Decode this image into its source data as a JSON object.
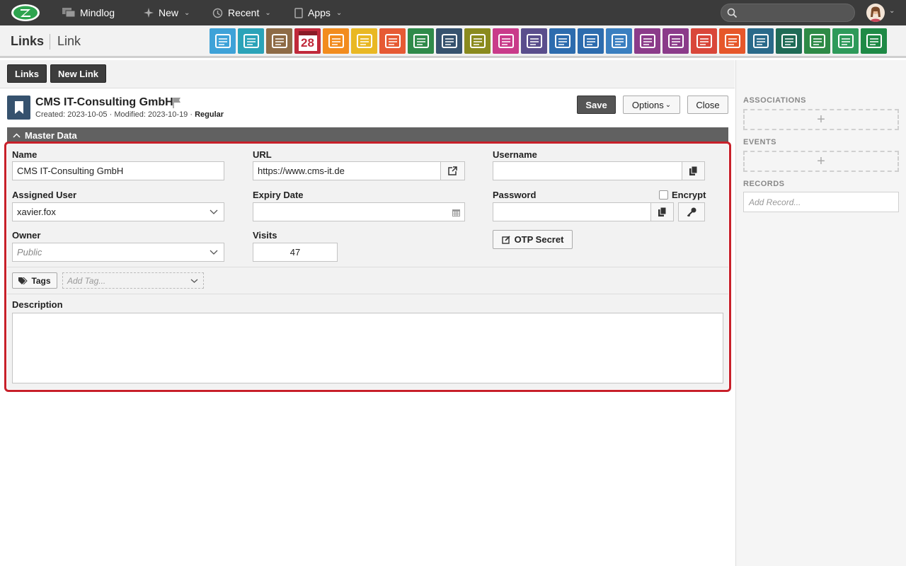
{
  "topnav": {
    "home": "Mindlog",
    "new": "New",
    "recent": "Recent",
    "apps": "Apps",
    "search_placeholder": ""
  },
  "breadcrumb": {
    "module": "Links",
    "page": "Link"
  },
  "app_icons": [
    {
      "name": "mail-icon",
      "color": "#3ea2d8"
    },
    {
      "name": "address-book-icon",
      "color": "#2ba3b8"
    },
    {
      "name": "contacts-icon",
      "color": "#8e6b46"
    },
    {
      "name": "calendar-icon",
      "color": "#c0293a",
      "text": "28"
    },
    {
      "name": "stopwatch-icon",
      "color": "#f28c1e"
    },
    {
      "name": "tasks-icon",
      "color": "#e9b824"
    },
    {
      "name": "projects-icon",
      "color": "#e65a34"
    },
    {
      "name": "notes-icon",
      "color": "#2f8a4a"
    },
    {
      "name": "bookmark-icon",
      "color": "#36526e"
    },
    {
      "name": "documents-icon",
      "color": "#8a8a1e"
    },
    {
      "name": "cashier-icon",
      "color": "#c93b8a"
    },
    {
      "name": "dollar-icon",
      "color": "#5a4e8c"
    },
    {
      "name": "truck-icon",
      "color": "#2d6cae"
    },
    {
      "name": "support-icon",
      "color": "#2d6cae"
    },
    {
      "name": "money-bag-icon",
      "color": "#3a7fc0"
    },
    {
      "name": "contract-icon",
      "color": "#8b3b8a"
    },
    {
      "name": "handshake-icon",
      "color": "#8b3b8a"
    },
    {
      "name": "pdf-icon",
      "color": "#d9473a"
    },
    {
      "name": "broadcast-icon",
      "color": "#e6572a"
    },
    {
      "name": "download-icon",
      "color": "#2a6a8a"
    },
    {
      "name": "cart-icon",
      "color": "#1f6b56"
    },
    {
      "name": "cash-icon",
      "color": "#2e8a46"
    },
    {
      "name": "price-tag-icon",
      "color": "#2e9a5a"
    },
    {
      "name": "database-icon",
      "color": "#1f8a46"
    }
  ],
  "toolbar": {
    "links_label": "Links",
    "new_link_label": "New Link"
  },
  "record": {
    "title": "CMS IT-Consulting GmbH",
    "created_label": "Created:",
    "created": "2023-10-05",
    "modified_label": "· Modified:",
    "modified": "2023-10-19",
    "type_sep": "·",
    "type": "Regular"
  },
  "actions": {
    "save": "Save",
    "options": "Options",
    "close": "Close"
  },
  "section": {
    "title": "Master Data"
  },
  "form": {
    "name_label": "Name",
    "name_value": "CMS IT-Consulting GmbH",
    "url_label": "URL",
    "url_value": "https://www.cms-it.de",
    "username_label": "Username",
    "username_value": "",
    "assigned_user_label": "Assigned User",
    "assigned_user_value": "xavier.fox",
    "expiry_label": "Expiry Date",
    "expiry_value": "",
    "password_label": "Password",
    "password_value": "",
    "encrypt_label": "Encrypt",
    "owner_label": "Owner",
    "owner_value": "Public",
    "visits_label": "Visits",
    "visits_value": "47",
    "otp_label": "OTP Secret",
    "tags_label": "Tags",
    "tags_placeholder": "Add Tag...",
    "description_label": "Description",
    "description_value": ""
  },
  "right_panel": {
    "associations": "ASSOCIATIONS",
    "events": "EVENTS",
    "records": "RECORDS",
    "records_placeholder": "Add Record..."
  },
  "colors": {
    "highlight": "#c8202a",
    "topbar": "#3b3b3b",
    "section": "#616161"
  }
}
